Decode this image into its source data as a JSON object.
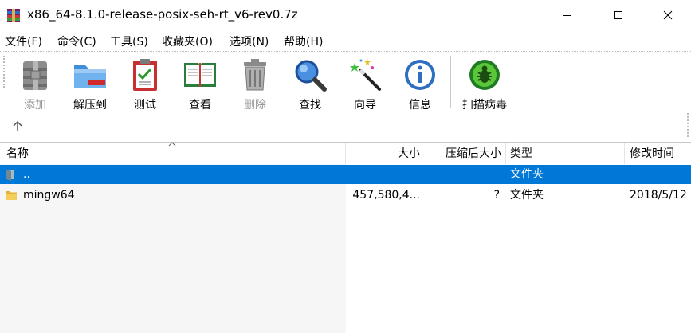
{
  "window": {
    "title": "x86_64-8.1.0-release-posix-seh-rt_v6-rev0.7z"
  },
  "menu": [
    {
      "label": "文件(F)"
    },
    {
      "label": "命令(C)"
    },
    {
      "label": "工具(S)"
    },
    {
      "label": "收藏夹(O)"
    },
    {
      "label": "选项(N)"
    },
    {
      "label": "帮助(H)"
    }
  ],
  "toolbar": [
    {
      "label": "添加",
      "icon": "add-archive-icon",
      "enabled": false
    },
    {
      "label": "解压到",
      "icon": "extract-folder-icon",
      "enabled": true
    },
    {
      "label": "测试",
      "icon": "test-clipboard-icon",
      "enabled": true
    },
    {
      "label": "查看",
      "icon": "view-book-icon",
      "enabled": true
    },
    {
      "label": "删除",
      "icon": "trash-icon",
      "enabled": false
    },
    {
      "label": "查找",
      "icon": "magnifier-icon",
      "enabled": true
    },
    {
      "label": "向导",
      "icon": "wizard-wand-icon",
      "enabled": true
    },
    {
      "label": "信息",
      "icon": "info-icon",
      "enabled": true
    },
    {
      "label": "扫描病毒",
      "icon": "virus-scan-icon",
      "enabled": true
    }
  ],
  "columns": {
    "name": "名称",
    "size": "大小",
    "packed": "压缩后大小",
    "type": "类型",
    "modified": "修改时间"
  },
  "rows": [
    {
      "name": "..",
      "size": "",
      "packed": "",
      "type": "文件夹",
      "modified": "",
      "selected": true
    },
    {
      "name": "mingw64",
      "size": "457,580,4...",
      "packed": "?",
      "type": "文件夹",
      "modified": "2018/5/12",
      "selected": false
    }
  ],
  "colors": {
    "selection": "#0078d7",
    "disabled_text": "#9a9a9a"
  }
}
